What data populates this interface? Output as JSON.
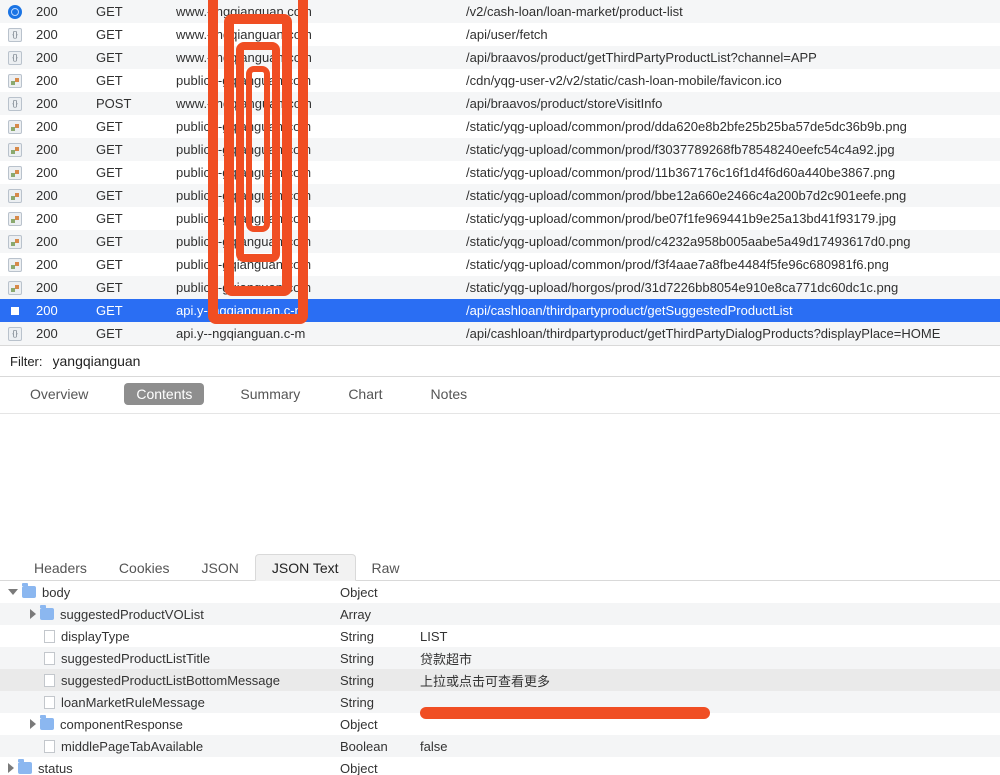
{
  "requests": [
    {
      "icon": "globe",
      "status": "200",
      "method": "GET",
      "host": "www.--ngqianguan.com",
      "path": "/v2/cash-loan/loan-market/product-list",
      "selected": false
    },
    {
      "icon": "curly",
      "status": "200",
      "method": "GET",
      "host": "www.--ngqianguan.com",
      "path": "/api/user/fetch",
      "selected": false
    },
    {
      "icon": "curly",
      "status": "200",
      "method": "GET",
      "host": "www.--ngqianguan.com",
      "path": "/api/braavos/product/getThirdPartyProductList?channel=APP",
      "selected": false
    },
    {
      "icon": "img",
      "status": "200",
      "method": "GET",
      "host": "public.--gqianguan.com",
      "path": "/cdn/yqg-user-v2/v2/static/cash-loan-mobile/favicon.ico",
      "selected": false
    },
    {
      "icon": "curly",
      "status": "200",
      "method": "POST",
      "host": "www.--ngqianguan.com",
      "path": "/api/braavos/product/storeVisitInfo",
      "selected": false
    },
    {
      "icon": "img",
      "status": "200",
      "method": "GET",
      "host": "public.--gqianguan.com",
      "path": "/static/yqg-upload/common/prod/dda620e8b2bfe25b25ba57de5dc36b9b.png",
      "selected": false
    },
    {
      "icon": "img",
      "status": "200",
      "method": "GET",
      "host": "public.--gqianguan.com",
      "path": "/static/yqg-upload/common/prod/f3037789268fb78548240eefc54c4a92.jpg",
      "selected": false
    },
    {
      "icon": "img",
      "status": "200",
      "method": "GET",
      "host": "public.--gqianguan.com",
      "path": "/static/yqg-upload/common/prod/11b367176c16f1d4f6d60a440be3867.png",
      "selected": false
    },
    {
      "icon": "img",
      "status": "200",
      "method": "GET",
      "host": "public.--gqianguan.com",
      "path": "/static/yqg-upload/common/prod/bbe12a660e2466c4a200b7d2c901eefe.png",
      "selected": false
    },
    {
      "icon": "img",
      "status": "200",
      "method": "GET",
      "host": "public.--gqianguan.com",
      "path": "/static/yqg-upload/common/prod/be07f1fe969441b9e25a13bd41f93179.jpg",
      "selected": false
    },
    {
      "icon": "img",
      "status": "200",
      "method": "GET",
      "host": "public.--gqianguan.com",
      "path": "/static/yqg-upload/common/prod/c4232a958b005aabe5a49d17493617d0.png",
      "selected": false
    },
    {
      "icon": "img",
      "status": "200",
      "method": "GET",
      "host": "public.--gqianguan.com",
      "path": "/static/yqg-upload/common/prod/f3f4aae7a8fbe4484f5fe96c680981f6.png",
      "selected": false
    },
    {
      "icon": "img",
      "status": "200",
      "method": "GET",
      "host": "public.--gqianguan.com",
      "path": "/static/yqg-upload/horgos/prod/31d7226bb8054e910e8ca771dc60dc1c.png",
      "selected": false
    },
    {
      "icon": "doc",
      "status": "200",
      "method": "GET",
      "host": "api.y--ngqianguan.c-m",
      "path": "/api/cashloan/thirdpartyproduct/getSuggestedProductList",
      "selected": true
    },
    {
      "icon": "curly",
      "status": "200",
      "method": "GET",
      "host": "api.y--ngqianguan.c-m",
      "path": "/api/cashloan/thirdpartyproduct/getThirdPartyDialogProducts?displayPlace=HOME",
      "selected": false
    }
  ],
  "filter": {
    "label": "Filter:",
    "value": "yangqianguan"
  },
  "midTabs": {
    "items": [
      "Overview",
      "Contents",
      "Summary",
      "Chart",
      "Notes"
    ],
    "active": "Contents"
  },
  "lowTabs": {
    "items": [
      "Headers",
      "Cookies",
      "JSON",
      "JSON Text",
      "Raw"
    ],
    "active": "JSON Text"
  },
  "tree": [
    {
      "indent": 0,
      "disclose": "open",
      "icon": "folder",
      "key": "body",
      "type": "Object",
      "value": "",
      "hl": false
    },
    {
      "indent": 1,
      "disclose": "closed",
      "icon": "folder",
      "key": "suggestedProductVOList",
      "type": "Array",
      "value": "",
      "hl": false
    },
    {
      "indent": 1,
      "disclose": "none",
      "icon": "file",
      "key": "displayType",
      "type": "String",
      "value": "LIST",
      "hl": false
    },
    {
      "indent": 1,
      "disclose": "none",
      "icon": "file",
      "key": "suggestedProductListTitle",
      "type": "String",
      "value": "贷款超市",
      "hl": false
    },
    {
      "indent": 1,
      "disclose": "none",
      "icon": "file",
      "key": "suggestedProductListBottomMessage",
      "type": "String",
      "value": "上拉或点击可查看更多",
      "hl": true
    },
    {
      "indent": 1,
      "disclose": "none",
      "icon": "file",
      "key": "loanMarketRuleMessage",
      "type": "String",
      "value": "",
      "hl": false,
      "redacted": true
    },
    {
      "indent": 1,
      "disclose": "closed",
      "icon": "folder",
      "key": "componentResponse",
      "type": "Object",
      "value": "",
      "hl": false
    },
    {
      "indent": 1,
      "disclose": "none",
      "icon": "file",
      "key": "middlePageTabAvailable",
      "type": "Boolean",
      "value": "false",
      "hl": false
    },
    {
      "indent": 0,
      "disclose": "closed",
      "icon": "folder",
      "key": "status",
      "type": "Object",
      "value": "",
      "hl": false
    }
  ]
}
